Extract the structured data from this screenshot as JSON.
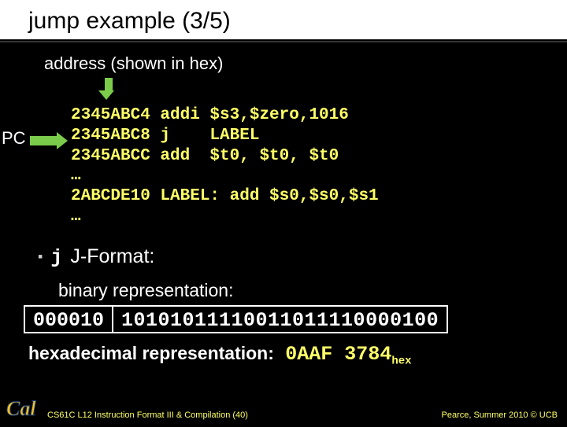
{
  "title": "jump example (3/5)",
  "subhead": "address (shown in hex)",
  "pc_label": "PC",
  "code": "2345ABC4 addi $s3,$zero,1016\n2345ABC8 j    LABEL\n2345ABCC add  $t0, $t0, $t0\n…\n2ABCDE10 LABEL: add $s0,$s0,$s1\n…",
  "bullet": {
    "j": "j",
    "text": "J-Format:"
  },
  "binary_label": "binary representation:",
  "binary": {
    "opcode": "000010",
    "target": "10101011110011011110000100"
  },
  "hex_label": "hexadecimal representation:",
  "hex_value": "0AAF 3784",
  "hex_sub": "hex",
  "footer_left": "CS61C L12 Instruction Format III & Compilation (40)",
  "footer_right": "Pearce, Summer 2010 © UCB"
}
